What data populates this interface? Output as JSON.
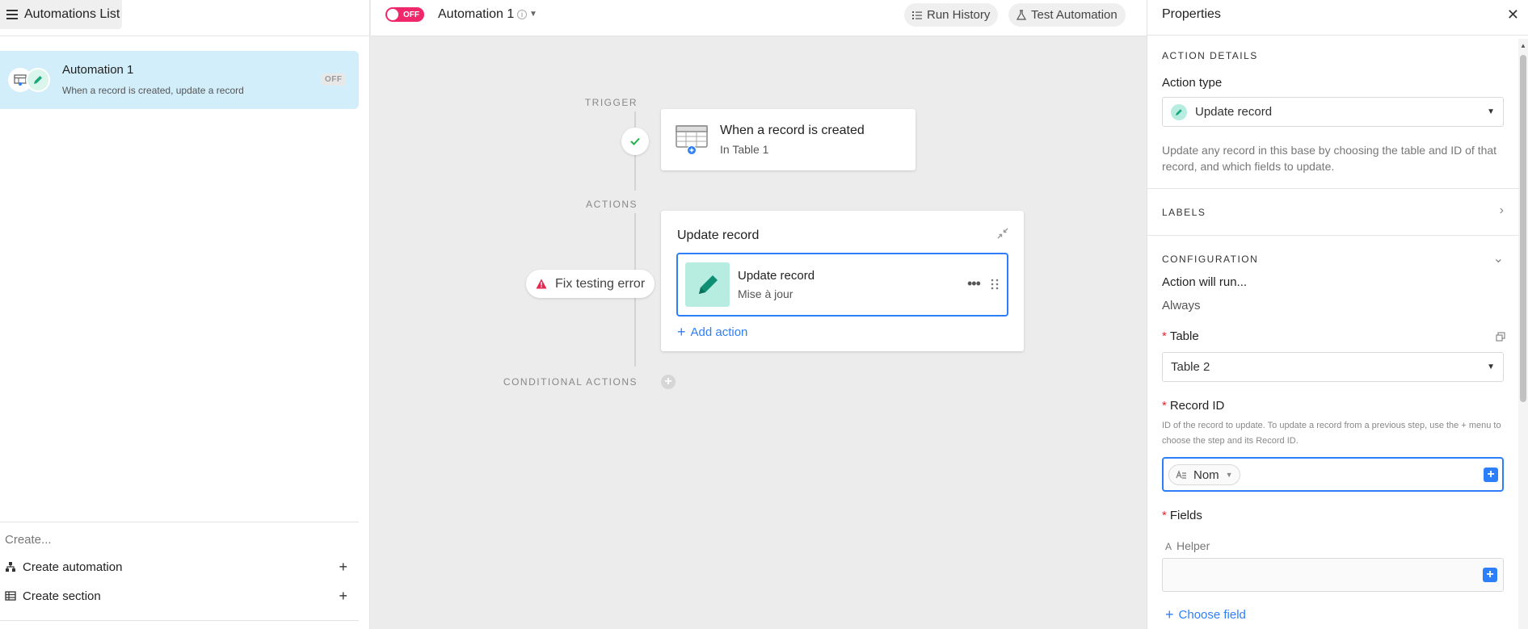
{
  "left": {
    "header_title": "Automations List",
    "automation": {
      "name": "Automation 1",
      "description": "When a record is created, update a record",
      "status": "OFF"
    },
    "create_label": "Create...",
    "create_automation": "Create automation",
    "create_section": "Create section"
  },
  "topbar": {
    "toggle_label": "OFF",
    "title": "Automation 1",
    "run_history": "Run History",
    "test_automation": "Test Automation"
  },
  "canvas": {
    "trigger_label": "TRIGGER",
    "actions_label": "ACTIONS",
    "conditional_label": "CONDITIONAL ACTIONS",
    "trigger_title": "When a record is created",
    "trigger_subtitle": "In Table 1",
    "fix_error": "Fix testing error",
    "action_card_title": "Update record",
    "action_title": "Update record",
    "action_subtitle": "Mise à jour",
    "add_action": "Add action"
  },
  "properties": {
    "title": "Properties",
    "action_details": "ACTION DETAILS",
    "action_type_label": "Action type",
    "action_type_value": "Update record",
    "action_description": "Update any record in this base by choosing the table and ID of that record, and which fields to update.",
    "labels": "LABELS",
    "configuration": "CONFIGURATION",
    "action_will_run": "Action will run...",
    "always": "Always",
    "table_label": "Table",
    "table_value": "Table 2",
    "record_id_label": "Record ID",
    "record_id_help": "ID of the record to update. To update a record from a previous step, use the + menu to choose the step and its Record ID.",
    "record_id_token": "Nom",
    "fields_label": "Fields",
    "helper_label": "Helper",
    "choose_field": "Choose field",
    "required_mark": "*"
  },
  "colors": {
    "accent_blue": "#2d7ff9",
    "toggle_red": "#f0286b",
    "selected_item": "#d2eefa",
    "action_teal": "#b7ede0"
  }
}
